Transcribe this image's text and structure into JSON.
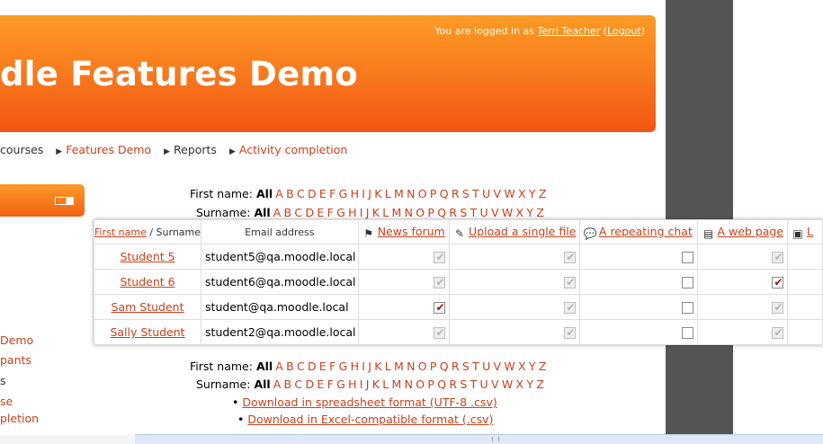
{
  "header": {
    "login_prefix": "You are logged in as",
    "user_name": "Terri Teacher",
    "logout": "Logout",
    "site_title": "dle Features Demo"
  },
  "breadcrumb": {
    "items": [
      "courses",
      "Features Demo",
      "Reports",
      "Activity completion"
    ]
  },
  "sidebar": {
    "items": [
      "Demo",
      "pants",
      "s",
      "se",
      "pletion"
    ]
  },
  "initials": {
    "first_label": "First name:",
    "surname_label": "Surname:",
    "all": "All",
    "letters": [
      "A",
      "B",
      "C",
      "D",
      "E",
      "F",
      "G",
      "H",
      "I",
      "J",
      "K",
      "L",
      "M",
      "N",
      "O",
      "P",
      "Q",
      "R",
      "S",
      "T",
      "U",
      "V",
      "W",
      "X",
      "Y",
      "Z"
    ]
  },
  "table": {
    "header_first": "First name",
    "header_sep": " / ",
    "header_surname": "Surname",
    "header_email": "Email address",
    "activities": [
      {
        "name": "News forum",
        "icon": "forum-icon"
      },
      {
        "name": "Upload a single file",
        "icon": "assignment-icon"
      },
      {
        "name": "A repeating chat",
        "icon": "chat-icon"
      },
      {
        "name": "A web page",
        "icon": "page-icon"
      },
      {
        "name": "L",
        "icon": "lesson-icon"
      }
    ],
    "rows": [
      {
        "name": "Student 5",
        "email": "student5@qa.moodle.local",
        "status": [
          "auto-done",
          "auto-done",
          "manual-empty",
          "auto-done",
          "none"
        ]
      },
      {
        "name": "Student 6",
        "email": "student6@qa.moodle.local",
        "status": [
          "auto-done",
          "auto-done",
          "manual-empty",
          "manual-done",
          "none"
        ]
      },
      {
        "name": "Sam Student",
        "email": "student@qa.moodle.local",
        "status": [
          "manual-done",
          "auto-done",
          "manual-empty",
          "auto-done",
          "none"
        ]
      },
      {
        "name": "Sally Student",
        "email": "student2@qa.moodle.local",
        "status": [
          "auto-done",
          "auto-done",
          "manual-empty",
          "auto-done",
          "none"
        ]
      }
    ]
  },
  "downloads": [
    "Download in spreadsheet format (UTF-8 .csv)",
    "Download in Excel-compatible format (.csv)"
  ]
}
